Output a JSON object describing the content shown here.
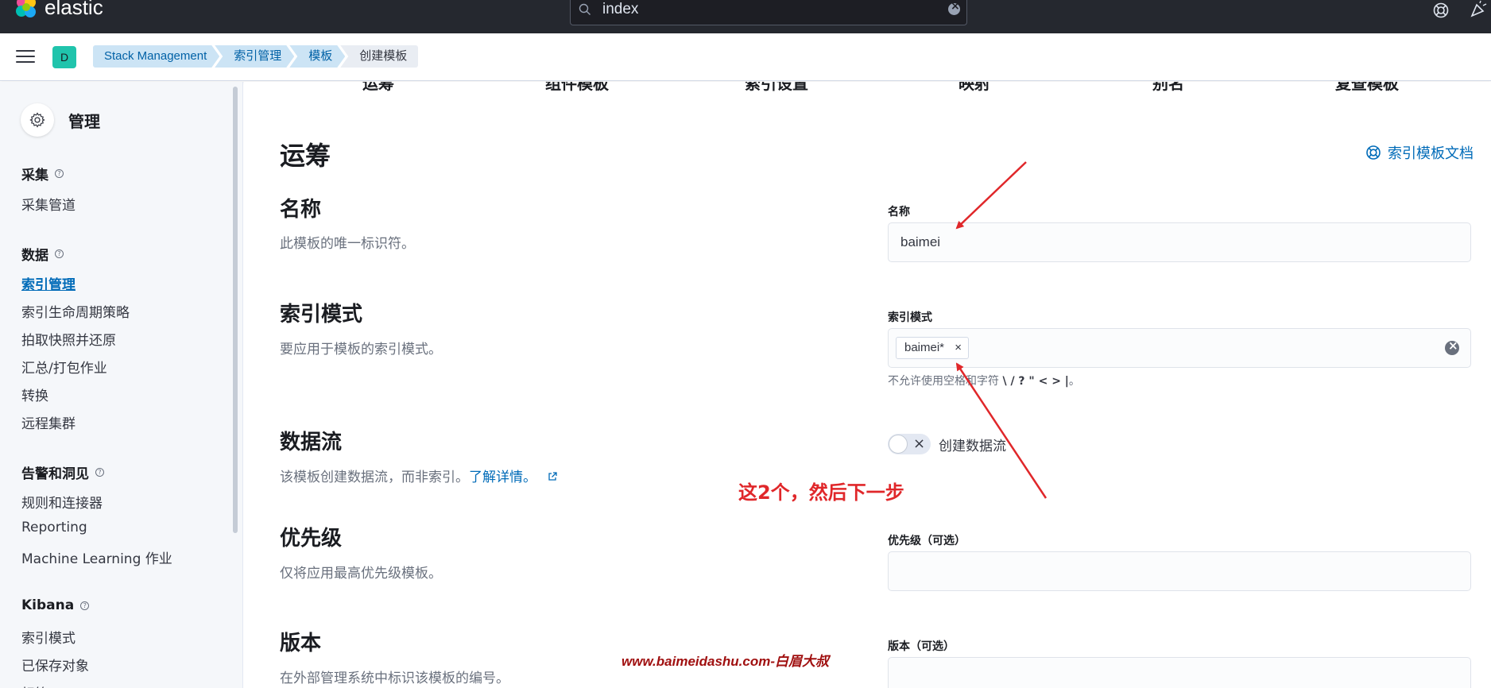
{
  "topbar": {
    "logo_text": "elastic",
    "search_value": "index"
  },
  "header": {
    "space_initial": "D",
    "breadcrumbs": [
      "Stack Management",
      "索引管理",
      "模板",
      "创建模板"
    ]
  },
  "sidebar": {
    "title": "管理",
    "groups": [
      {
        "title": "采集",
        "items": [
          "采集管道"
        ]
      },
      {
        "title": "数据",
        "items": [
          "索引管理",
          "索引生命周期策略",
          "拍取快照并还原",
          "汇总/打包作业",
          "转换",
          "远程集群"
        ]
      },
      {
        "title": "告警和洞见",
        "items": [
          "规则和连接器",
          "Reporting",
          "Machine Learning 作业"
        ]
      },
      {
        "title": "Kibana",
        "items": [
          "索引模式",
          "已保存对象",
          "标签"
        ]
      }
    ],
    "active_item": "索引管理"
  },
  "steps": [
    "运筹",
    "组件模板",
    "索引设置",
    "映射",
    "别名",
    "复查模板"
  ],
  "main": {
    "page_title": "运筹",
    "doc_link": "索引模板文档",
    "sections": {
      "name": {
        "title": "名称",
        "desc": "此模板的唯一标识符。",
        "label": "名称",
        "value": "baimei"
      },
      "pattern": {
        "title": "索引模式",
        "desc": "要应用于模板的索引模式。",
        "label": "索引模式",
        "pill": "baimei*",
        "help_prefix": "不允许使用空格和字符",
        "help_chars": "\\ / ? \" < > |",
        "help_suffix": "。"
      },
      "datastream": {
        "title": "数据流",
        "desc": "该模板创建数据流，而非索引。",
        "link": "了解详情。",
        "toggle_label": "创建数据流"
      },
      "priority": {
        "title": "优先级",
        "desc": "仅将应用最高优先级模板。",
        "label": "优先级（可选）",
        "value": ""
      },
      "version": {
        "title": "版本",
        "desc": "在外部管理系统中标识该模板的编号。",
        "label": "版本（可选）",
        "value": ""
      }
    }
  },
  "annotation": {
    "note": "这2个，然后下一步",
    "watermark": "www.baimeidashu.com-白眉大叔",
    "color": "#e0272a"
  }
}
